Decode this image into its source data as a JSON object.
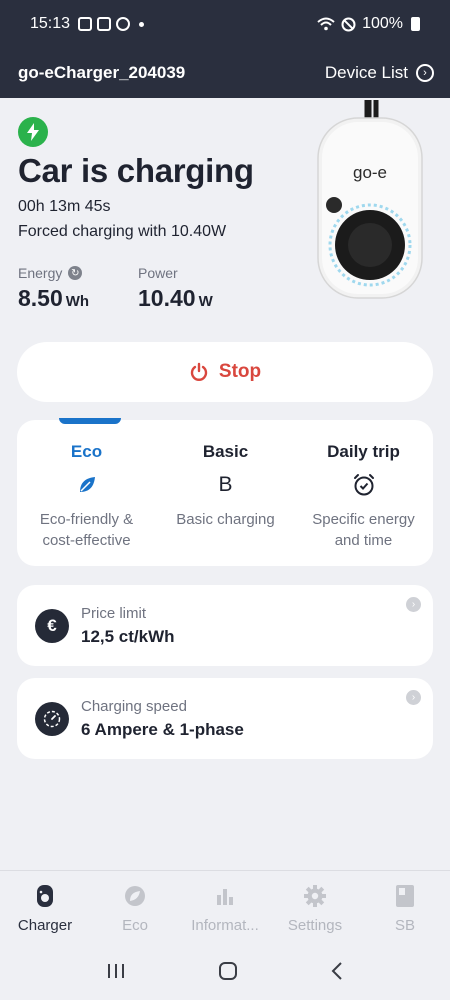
{
  "statusbar": {
    "time": "15:13",
    "battery": "100%"
  },
  "appbar": {
    "device_name": "go-eCharger_204039",
    "device_list_label": "Device List"
  },
  "status": {
    "headline": "Car is charging",
    "duration": "00h 13m 45s",
    "note": "Forced charging with 10.40W"
  },
  "metrics": {
    "energy_label": "Energy",
    "energy_value": "8.50",
    "energy_unit": "Wh",
    "power_label": "Power",
    "power_value": "10.40",
    "power_unit": "W"
  },
  "charger_logo": "go-e",
  "stop_label": "Stop",
  "modes": [
    {
      "title": "Eco",
      "icon": "leaf-icon",
      "desc_line1": "Eco-friendly &",
      "desc_line2": "cost-effective",
      "selected": true
    },
    {
      "title": "Basic",
      "icon": "B",
      "desc_line1": "Basic charging",
      "desc_line2": "",
      "selected": false
    },
    {
      "title": "Daily trip",
      "icon": "alarm-clock-icon",
      "desc_line1": "Specific energy",
      "desc_line2": "and time",
      "selected": false
    }
  ],
  "price_limit": {
    "label": "Price limit",
    "value": "12,5 ct/kWh",
    "icon": "€"
  },
  "charging_speed": {
    "label": "Charging speed",
    "value": "6 Ampere & 1-phase"
  },
  "bottom_nav": [
    {
      "label": "Charger",
      "active": true
    },
    {
      "label": "Eco",
      "active": false
    },
    {
      "label": "Informat...",
      "active": false
    },
    {
      "label": "Settings",
      "active": false
    },
    {
      "label": "SB",
      "active": false
    }
  ],
  "colors": {
    "header": "#2a2f3e",
    "accent": "#1a73c9",
    "stop": "#d9473e",
    "charging": "#2bb24c"
  }
}
